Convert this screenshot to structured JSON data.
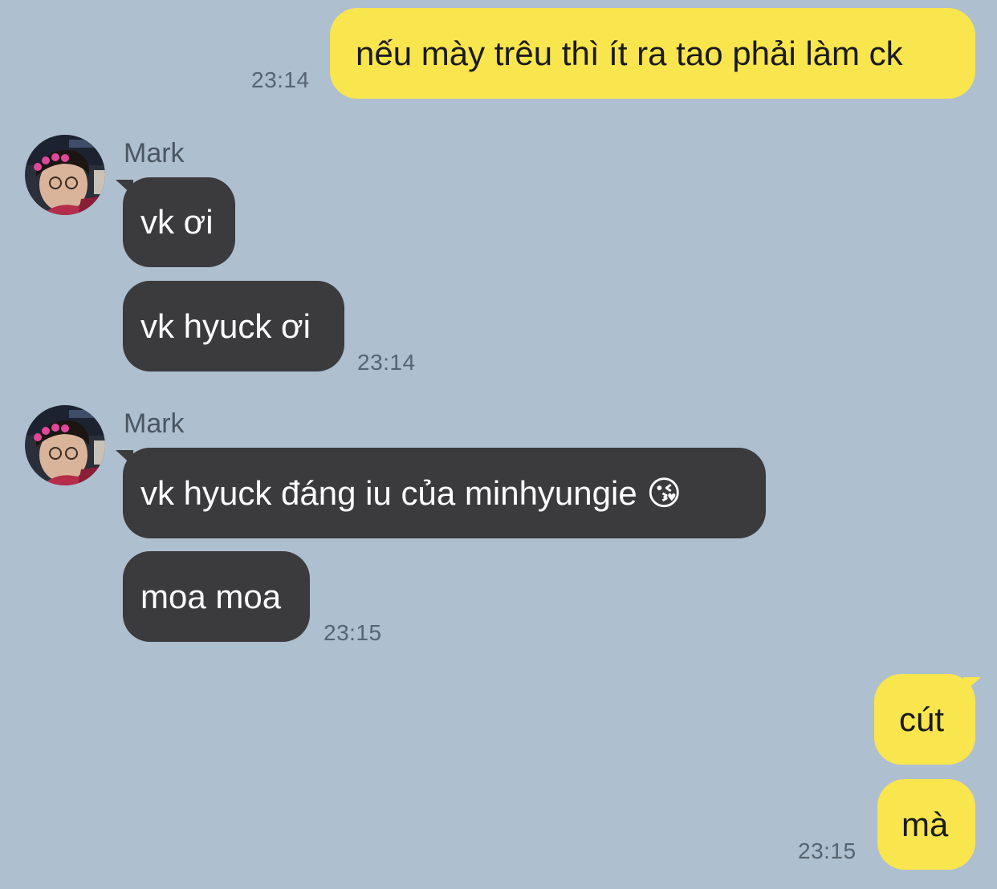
{
  "messages": [
    {
      "side": "out",
      "text": "nếu mày trêu thì ít ra tao phải làm ck",
      "time": "23:14"
    },
    {
      "side": "in",
      "sender": "Mark",
      "text": "vk ơi"
    },
    {
      "side": "in",
      "text": "vk hyuck ơi",
      "time": "23:14"
    },
    {
      "side": "in",
      "sender": "Mark",
      "text": "vk hyuck đáng iu của minhyungie 😘"
    },
    {
      "side": "in",
      "text": "moa moa",
      "time": "23:15"
    },
    {
      "side": "out",
      "text": "cút"
    },
    {
      "side": "out",
      "text": "mà",
      "time": "23:15"
    }
  ],
  "avatar_icon": "profile-photo-avatar",
  "colors": {
    "background": "#aebfcf",
    "outgoing_bubble": "#f9e54e",
    "incoming_bubble": "#3b3a3d",
    "timestamp": "#566471"
  }
}
